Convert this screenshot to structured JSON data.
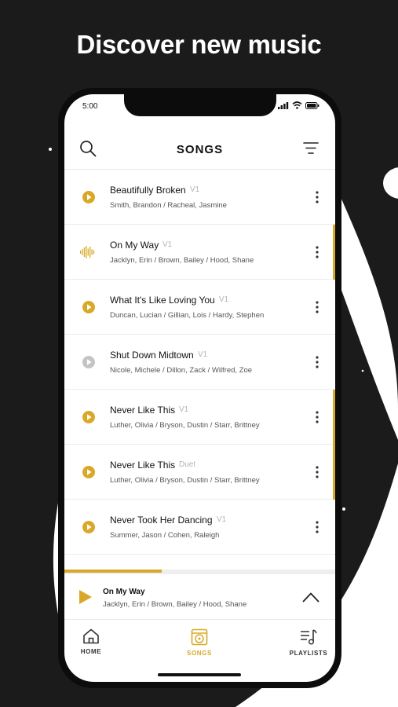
{
  "headline": "Discover new music",
  "colors": {
    "accent": "#d8a928",
    "background": "#1b1b1b",
    "muted_icon": "#c4c4c4"
  },
  "status_bar": {
    "time": "5:00",
    "icons": [
      "signal-icon",
      "wifi-icon",
      "battery-icon"
    ]
  },
  "header": {
    "title": "SONGS",
    "left_icon": "search-icon",
    "right_icon": "filter-icon"
  },
  "songs": [
    {
      "title": "Beautifully Broken",
      "version": "V1",
      "artists": "Smith, Brandon / Racheal, Jasmine",
      "icon": "play-icon",
      "icon_state": "default",
      "marked": false
    },
    {
      "title": "On My Way",
      "version": "V1",
      "artists": "Jacklyn, Erin / Brown, Bailey / Hood, Shane",
      "icon": "waveform-icon",
      "icon_state": "playing",
      "marked": true
    },
    {
      "title": "What It's Like Loving You",
      "version": "V1",
      "artists": "Duncan, Lucian / Gillian, Lois / Hardy, Stephen",
      "icon": "play-icon",
      "icon_state": "default",
      "marked": false
    },
    {
      "title": "Shut Down Midtown",
      "version": "V1",
      "artists": "Nicole, Michele / Dillon, Zack / Wilfred, Zoe",
      "icon": "play-icon",
      "icon_state": "disabled",
      "marked": false
    },
    {
      "title": "Never Like This",
      "version": "V1",
      "artists": "Luther, Olivia / Bryson, Dustin / Starr, Brittney",
      "icon": "play-icon",
      "icon_state": "default",
      "marked": true
    },
    {
      "title": "Never Like This",
      "version": "Duet",
      "artists": "Luther, Olivia / Bryson, Dustin / Starr, Brittney",
      "icon": "play-icon",
      "icon_state": "default",
      "marked": true
    },
    {
      "title": "Never Took Her Dancing",
      "version": "V1",
      "artists": "Summer, Jason / Cohen, Raleigh",
      "icon": "play-icon",
      "icon_state": "default",
      "marked": false
    }
  ],
  "now_playing": {
    "title": "On My Way",
    "artists": "Jacklyn, Erin / Brown, Bailey / Hood, Shane",
    "progress": 0.36
  },
  "tabs": [
    {
      "label": "HOME",
      "icon": "home-icon",
      "active": false
    },
    {
      "label": "SONGS",
      "icon": "record-icon",
      "active": true
    },
    {
      "label": "PLAYLISTS",
      "icon": "playlist-icon",
      "active": false
    }
  ]
}
